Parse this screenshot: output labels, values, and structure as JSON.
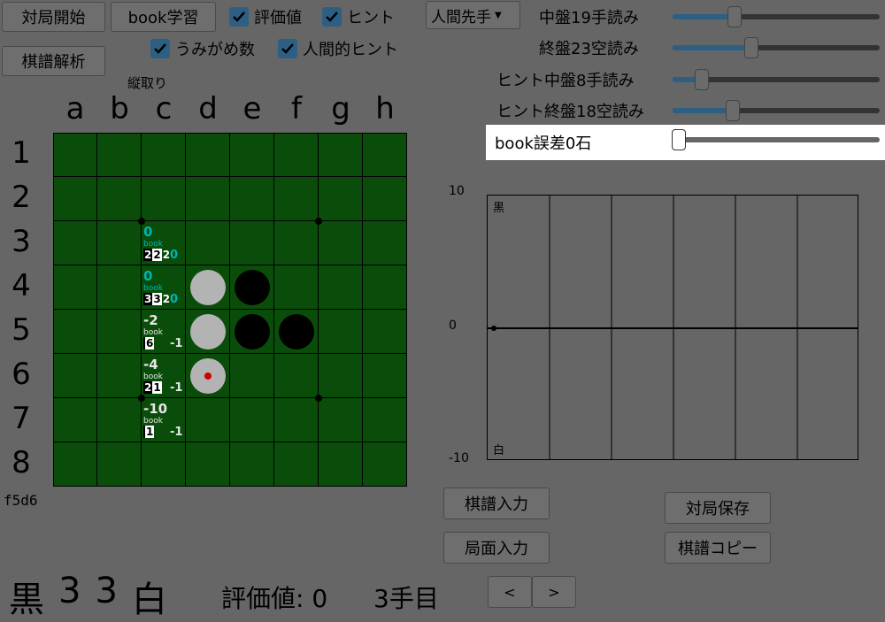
{
  "buttons": {
    "start_game": "対局開始",
    "book_learn": "book学習",
    "record_analysis": "棋譜解析",
    "record_input": "棋譜入力",
    "position_input": "局面入力",
    "save_game": "対局保存",
    "copy_record": "棋譜コピー",
    "prev": "<",
    "next": ">"
  },
  "checkboxes": {
    "eval": "評価値",
    "hint": "ヒント",
    "umigame": "うみがめ数",
    "human_hint": "人間的ヒント"
  },
  "dropdown": {
    "selected": "人間先手"
  },
  "vertical_take": "縦取り",
  "settings": {
    "mid_depth": {
      "label": "中盤19手読み",
      "value": 0.3
    },
    "end_depth": {
      "label": "終盤23空読み",
      "value": 0.38
    },
    "hint_mid": {
      "label": "ヒント中盤8手読み",
      "value": 0.14
    },
    "hint_end": {
      "label": "ヒント終盤18空読み",
      "value": 0.29
    },
    "book_error": {
      "label": "book誤差0石",
      "value": 0.0
    }
  },
  "board": {
    "cols": [
      "a",
      "b",
      "c",
      "d",
      "e",
      "f",
      "g",
      "h"
    ],
    "rows": [
      "1",
      "2",
      "3",
      "4",
      "5",
      "6",
      "7",
      "8"
    ],
    "discs": [
      {
        "cell": "d4",
        "color": "white"
      },
      {
        "cell": "e4",
        "color": "black"
      },
      {
        "cell": "d5",
        "color": "white"
      },
      {
        "cell": "e5",
        "color": "black"
      },
      {
        "cell": "f5",
        "color": "black"
      },
      {
        "cell": "d6",
        "color": "white",
        "last_move": true
      }
    ],
    "hints": [
      {
        "cell": "c3",
        "value": "0",
        "book": "book",
        "n1": "2",
        "n2": "2",
        "n3": "2",
        "h": "0",
        "color": "#00b4b4"
      },
      {
        "cell": "c4",
        "value": "0",
        "book": "book",
        "n1": "3",
        "n2": "3",
        "n3": "2",
        "h": "0",
        "color": "#00b4b4"
      },
      {
        "cell": "c5",
        "value": "-2",
        "book": "book",
        "n1": "",
        "n2": "6",
        "n3": "",
        "h": "-1",
        "color": "#e6e6e6"
      },
      {
        "cell": "c6",
        "value": "-4",
        "book": "book",
        "n1": "2",
        "n2": "1",
        "n3": "",
        "h": "-1",
        "color": "#e6e6e6"
      },
      {
        "cell": "c7",
        "value": "-10",
        "book": "book",
        "n1": "",
        "n2": "1",
        "n3": "",
        "h": "-1",
        "color": "#e6e6e6"
      }
    ]
  },
  "record": "f5d6",
  "graph": {
    "y_top": "10",
    "y_mid": "0",
    "y_bottom": "-10",
    "black_label": "黒",
    "white_label": "白"
  },
  "status": {
    "black": "黒",
    "black_count": "3",
    "white_count": "3",
    "white": "白",
    "eval": "評価値: 0",
    "move": "3手目"
  },
  "colors": {
    "board": "#0a4d0a",
    "accent": "#2d5f85",
    "background": "#666666"
  }
}
